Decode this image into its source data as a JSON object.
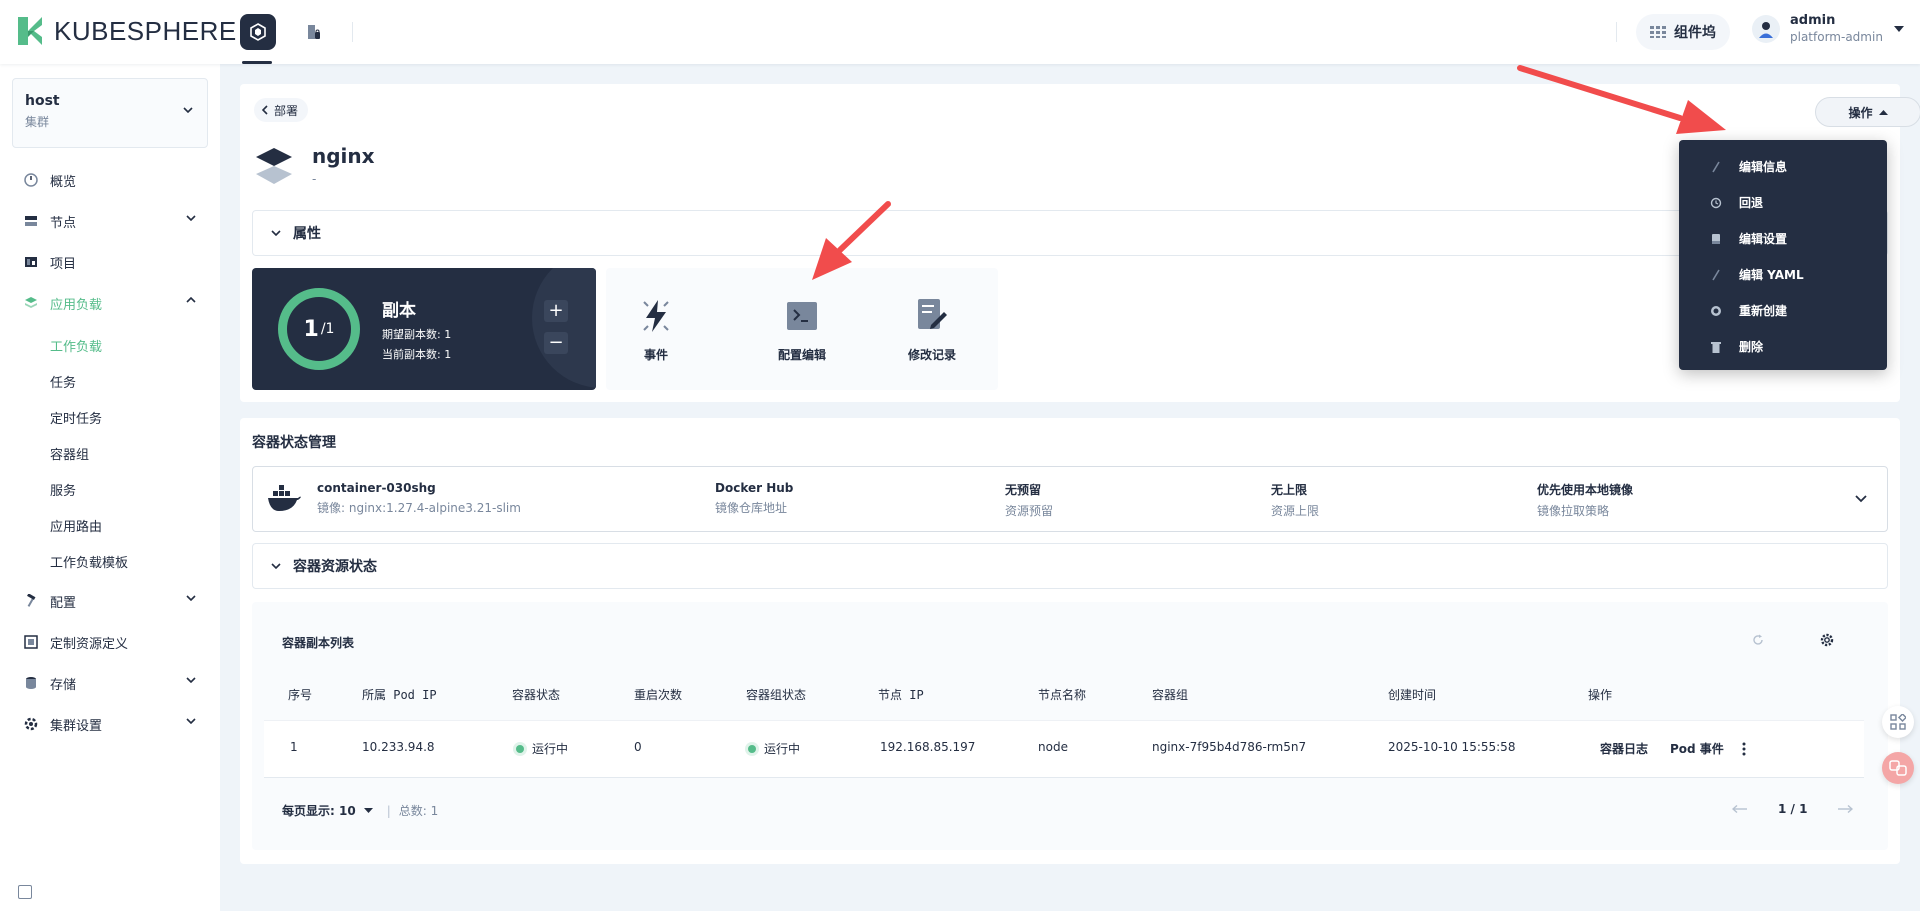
{
  "topbar": {
    "logo_text": "KUBESPHERE",
    "toolbox_label": "组件坞",
    "user_name": "admin",
    "user_role": "platform-admin"
  },
  "sidebar": {
    "cluster_name": "host",
    "cluster_type": "集群",
    "items": [
      {
        "label": "概览",
        "icon": "dashboard-icon"
      },
      {
        "label": "节点",
        "icon": "server-icon"
      },
      {
        "label": "项目",
        "icon": "project-icon"
      },
      {
        "label": "应用负载",
        "icon": "appstack-icon"
      },
      {
        "label": "配置",
        "icon": "hammer-icon"
      },
      {
        "label": "定制资源定义",
        "icon": "crd-icon"
      },
      {
        "label": "存储",
        "icon": "storage-icon"
      },
      {
        "label": "集群设置",
        "icon": "cluster-settings-icon"
      }
    ],
    "sub_items": [
      "工作负载",
      "任务",
      "定时任务",
      "容器组",
      "服务",
      "应用路由",
      "工作负载模板"
    ]
  },
  "detail": {
    "back_label": "部署",
    "name": "nginx",
    "description": "-",
    "ops_label": "操作",
    "attr_label": "属性"
  },
  "replica": {
    "current": "1",
    "total": "/1",
    "title": "副本",
    "desired": "期望副本数: 1",
    "actual": "当前副本数: 1"
  },
  "tools": [
    "事件",
    "配置编辑",
    "修改记录"
  ],
  "dropdown": [
    {
      "label": "编辑信息",
      "icon": "pencil-icon"
    },
    {
      "label": "回退",
      "icon": "history-icon"
    },
    {
      "label": "编辑设置",
      "icon": "settings-icon"
    },
    {
      "label": "编辑 YAML",
      "icon": "pencil-icon"
    },
    {
      "label": "重新创建",
      "icon": "recreate-icon"
    },
    {
      "label": "删除",
      "icon": "trash-icon"
    }
  ],
  "container": {
    "section_title": "容器状态管理",
    "name": "container-030shg",
    "image": "镜像: nginx:1.27.4-alpine3.21-slim",
    "registry": "Docker Hub",
    "registry_label": "镜像仓库地址",
    "reserve": "无预留",
    "reserve_label": "资源预留",
    "limit": "无上限",
    "limit_label": "资源上限",
    "pull": "优先使用本地镜像",
    "pull_label": "镜像拉取策略",
    "resource_status_label": "容器资源状态"
  },
  "table": {
    "title": "容器副本列表",
    "headers": [
      "序号",
      "所属 Pod IP",
      "容器状态",
      "重启次数",
      "容器组状态",
      "节点 IP",
      "节点名称",
      "容器组",
      "创建时间",
      "操作"
    ],
    "row": {
      "index": "1",
      "pod_ip": "10.233.94.8",
      "container_status": "运行中",
      "restarts": "0",
      "pod_status": "运行中",
      "node_ip": "192.168.85.197",
      "node_name": "node",
      "pod": "nginx-7f95b4d786-rm5n7",
      "created": "2025-10-10 15:55:58",
      "action_logs": "容器日志",
      "action_events": "Pod 事件"
    },
    "page_size": "每页显示: 10",
    "total": "总数: 1",
    "page": "1 / 1"
  },
  "colors": {
    "accent": "#55bc8a",
    "dark": "#242e42",
    "arrow": "#f14c4c"
  }
}
